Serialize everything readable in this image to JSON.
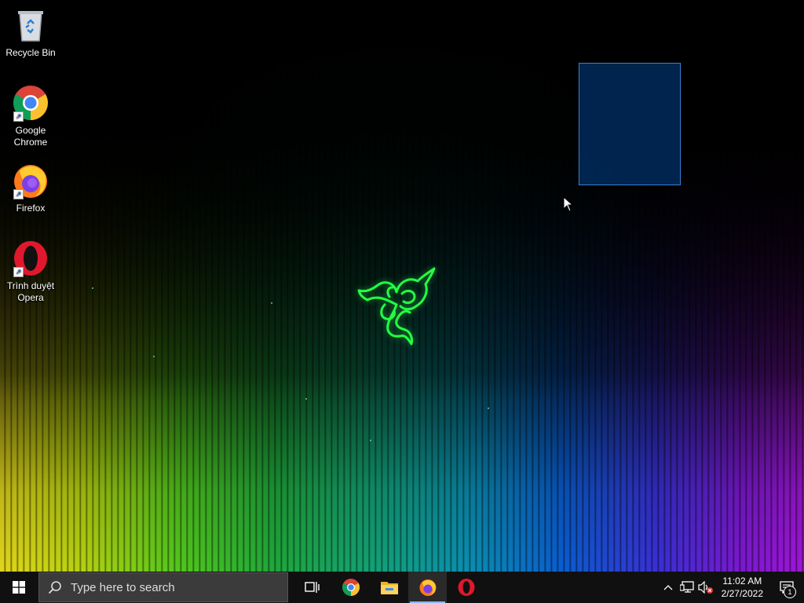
{
  "desktop": {
    "icons": [
      {
        "label": "Recycle Bin",
        "icon": "recycle-bin-icon"
      },
      {
        "label": "Google Chrome",
        "icon": "chrome-icon"
      },
      {
        "label": "Firefox",
        "icon": "firefox-icon"
      },
      {
        "label": "Trình duyệt Opera",
        "icon": "opera-icon"
      }
    ],
    "wallpaper": {
      "theme": "razer",
      "accent": "#22ff44"
    }
  },
  "taskbar": {
    "search_placeholder": "Type here to search",
    "pinned": [
      {
        "name": "Task View",
        "icon": "task-view-icon"
      },
      {
        "name": "Google Chrome",
        "icon": "chrome-icon"
      },
      {
        "name": "File Explorer",
        "icon": "folder-icon"
      },
      {
        "name": "Firefox",
        "icon": "firefox-icon",
        "active": true
      },
      {
        "name": "Opera",
        "icon": "opera-icon"
      }
    ],
    "tray": {
      "time": "11:02 AM",
      "date": "2/27/2022",
      "notification_count": "1"
    }
  }
}
